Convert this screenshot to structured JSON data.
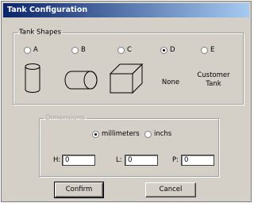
{
  "window": {
    "title": "Tank Configuration"
  },
  "shapes_group": {
    "legend": "Tank Shapes",
    "options": [
      {
        "label": "A",
        "checked": false,
        "icon": "cylinder-icon"
      },
      {
        "label": "B",
        "checked": false,
        "icon": "capsule-icon"
      },
      {
        "label": "C",
        "checked": false,
        "icon": "box-icon"
      },
      {
        "label": "D",
        "checked": true,
        "icon": "none"
      },
      {
        "label": "E",
        "checked": false,
        "icon": "none"
      }
    ],
    "captions": {
      "none": "None",
      "custom_line1": "Customer",
      "custom_line2": "Tank"
    }
  },
  "dimensions_group": {
    "legend": "Dimensions",
    "units": [
      {
        "label": "millimeters",
        "checked": true
      },
      {
        "label": "inchs",
        "checked": false
      }
    ],
    "fields": [
      {
        "label": "H:",
        "value": "0"
      },
      {
        "label": "L:",
        "value": "0"
      },
      {
        "label": "P:",
        "value": "0"
      }
    ]
  },
  "buttons": {
    "confirm": "Confirm",
    "cancel": "Cancel"
  }
}
